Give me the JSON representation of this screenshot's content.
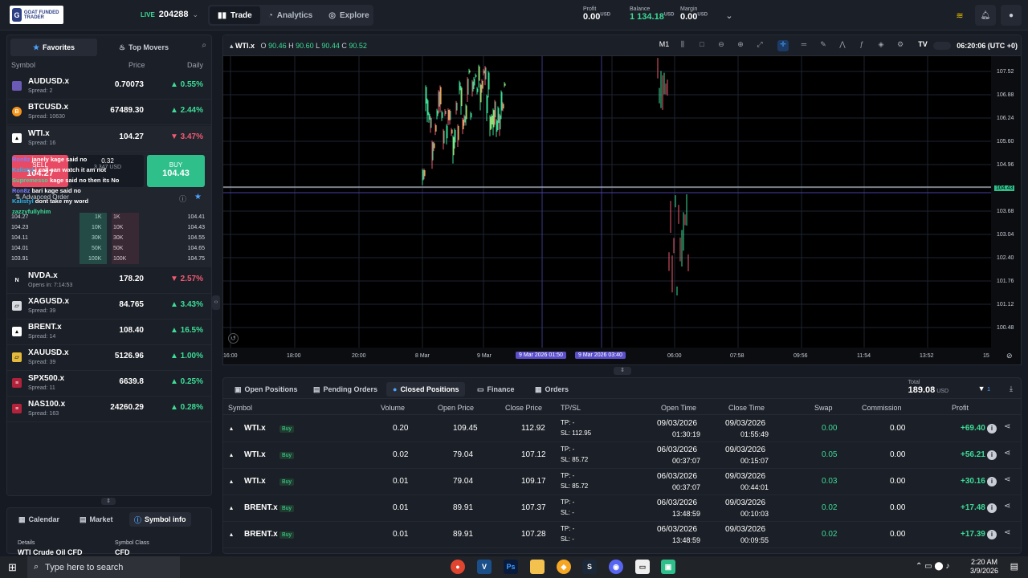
{
  "logo": {
    "text": "GOAT FUNDED TRADER"
  },
  "header": {
    "live_label": "LIVE",
    "account": "204288",
    "nav": [
      {
        "label": "Trade"
      },
      {
        "label": "Analytics"
      },
      {
        "label": "Explore"
      }
    ],
    "profit": {
      "label": "Profit",
      "value": "0.00",
      "unit": "USD"
    },
    "balance": {
      "label": "Balance",
      "value": "1 134.18",
      "unit": "USD"
    },
    "margin": {
      "label": "Margin",
      "value": "0.00",
      "unit": "USD"
    }
  },
  "watchlist": {
    "tabs": [
      "Favorites",
      "Top Movers"
    ],
    "col_symbol": "Symbol",
    "col_price": "Price",
    "col_daily": "Daily",
    "rows": [
      {
        "sym": "AUDUSD.x",
        "sub": "Spread: 2",
        "price": "0.70073",
        "daily": "0.55%",
        "dir": "up"
      },
      {
        "sym": "BTCUSD.x",
        "sub": "Spread: 10630",
        "price": "67489.30",
        "daily": "2.44%",
        "dir": "up"
      },
      {
        "sym": "WTI.x",
        "sub": "Spread: 16",
        "price": "104.27",
        "daily": "3.47%",
        "dir": "dn"
      },
      {
        "sym": "NVDA.x",
        "sub": "Opens in: 7:14:53",
        "price": "178.20",
        "daily": "2.57%",
        "dir": "dn"
      },
      {
        "sym": "XAGUSD.x",
        "sub": "Spread: 39",
        "price": "84.765",
        "daily": "3.43%",
        "dir": "up"
      },
      {
        "sym": "BRENT.x",
        "sub": "Spread: 14",
        "price": "108.40",
        "daily": "16.5%",
        "dir": "up"
      },
      {
        "sym": "XAUUSD.x",
        "sub": "Spread: 39",
        "price": "5126.96",
        "daily": "1.00%",
        "dir": "up"
      },
      {
        "sym": "SPX500.x",
        "sub": "Spread: 11",
        "price": "6639.8",
        "daily": "0.25%",
        "dir": "up"
      },
      {
        "sym": "NAS100.x",
        "sub": "Spread: 163",
        "price": "24260.29",
        "daily": "0.28%",
        "dir": "up"
      }
    ]
  },
  "order": {
    "sell_label": "SELL",
    "sell_price": "104.27",
    "buy_label": "BUY",
    "buy_price": "104.43",
    "lot": "0.32",
    "lot_sub": "3 347 USD",
    "advanced": "Advanced Order",
    "depth": [
      {
        "bid": "104.27",
        "bv": "1K",
        "av": "1K",
        "ask": "104.41"
      },
      {
        "bid": "104.23",
        "bv": "10K",
        "av": "10K",
        "ask": "104.43"
      },
      {
        "bid": "104.11",
        "bv": "30K",
        "av": "30K",
        "ask": "104.55"
      },
      {
        "bid": "104.01",
        "bv": "50K",
        "av": "50K",
        "ask": "104.65"
      },
      {
        "bid": "103.91",
        "bv": "100K",
        "av": "100K",
        "ask": "104.75"
      }
    ]
  },
  "chat": [
    {
      "name": "Ron8z",
      "text": "janely kage said no"
    },
    {
      "name": "Kalistyl",
      "text": "i call can watch it am not"
    },
    {
      "name": "Supremesso",
      "text": "kage said no then its No"
    },
    {
      "name": "Ron8z",
      "text": "bari kage said no"
    },
    {
      "name": "Kalistyl",
      "text": "dont take my word"
    },
    {
      "name": "zazzyfullyhim",
      "text": ""
    }
  ],
  "left_bottom": {
    "tabs": [
      "Calendar",
      "Market",
      "Symbol info"
    ],
    "details_label": "Details",
    "details_value": "WTI Crude Oil CFD",
    "class_label": "Symbol Class",
    "class_value": "CFD"
  },
  "chart": {
    "symbol": "WTI.x",
    "o": "90.46",
    "h": "90.60",
    "l": "90.44",
    "c": "90.52",
    "timeframe": "M1",
    "clock": "06:20:06 (UTC +0)",
    "yticks": [
      "107.52",
      "106.88",
      "106.24",
      "105.60",
      "104.96",
      "104.32",
      "103.68",
      "103.04",
      "102.40",
      "101.76",
      "101.12",
      "100.48"
    ],
    "current": "104.43",
    "xticks": [
      "16:00",
      "18:00",
      "20:00",
      "8 Mar",
      "9 Mar",
      "9 Mar 2026 01:50",
      "9 Mar 2026 03:40",
      "06:00",
      "07:58",
      "09:56",
      "11:54",
      "13:52",
      "15"
    ]
  },
  "positions": {
    "tabs": [
      "Open Positions",
      "Pending Orders",
      "Closed Positions",
      "Finance",
      "Orders"
    ],
    "total_label": "Total",
    "total": "189.08",
    "total_unit": "USD",
    "filter_count": "1",
    "headers": [
      "Symbol",
      "Volume",
      "Open Price",
      "Close Price",
      "TP/SL",
      "Open Time",
      "Close Time",
      "Swap",
      "Commission",
      "Profit"
    ],
    "rows": [
      {
        "sym": "WTI.x",
        "side": "Buy",
        "vol": "0.20",
        "open": "109.45",
        "close": "112.92",
        "tp": "TP: -",
        "sl": "SL: 112.95",
        "od": "09/03/2026",
        "ot": "01:30:19",
        "cd": "09/03/2026",
        "ct": "01:55:49",
        "swap": "0.00",
        "comm": "0.00",
        "profit": "+69.40"
      },
      {
        "sym": "WTI.x",
        "side": "Buy",
        "vol": "0.02",
        "open": "79.04",
        "close": "107.12",
        "tp": "TP: -",
        "sl": "SL: 85.72",
        "od": "06/03/2026",
        "ot": "00:37:07",
        "cd": "09/03/2026",
        "ct": "00:15:07",
        "swap": "0.05",
        "comm": "0.00",
        "profit": "+56.21"
      },
      {
        "sym": "WTI.x",
        "side": "Buy",
        "vol": "0.01",
        "open": "79.04",
        "close": "109.17",
        "tp": "TP: -",
        "sl": "SL: 85.72",
        "od": "06/03/2026",
        "ot": "00:37:07",
        "cd": "09/03/2026",
        "ct": "00:44:01",
        "swap": "0.03",
        "comm": "0.00",
        "profit": "+30.16"
      },
      {
        "sym": "BRENT.x",
        "side": "Buy",
        "vol": "0.01",
        "open": "89.91",
        "close": "107.37",
        "tp": "TP: -",
        "sl": "SL: -",
        "od": "06/03/2026",
        "ot": "13:48:59",
        "cd": "09/03/2026",
        "ct": "00:10:03",
        "swap": "0.02",
        "comm": "0.00",
        "profit": "+17.48"
      },
      {
        "sym": "BRENT.x",
        "side": "Buy",
        "vol": "0.01",
        "open": "89.91",
        "close": "107.28",
        "tp": "TP: -",
        "sl": "SL: -",
        "od": "06/03/2026",
        "ot": "13:48:59",
        "cd": "09/03/2026",
        "ct": "00:09:55",
        "swap": "0.02",
        "comm": "0.00",
        "profit": "+17.39"
      }
    ]
  },
  "taskbar": {
    "search": "Type here to search",
    "time": "2:20 AM",
    "date": "3/9/2026"
  }
}
